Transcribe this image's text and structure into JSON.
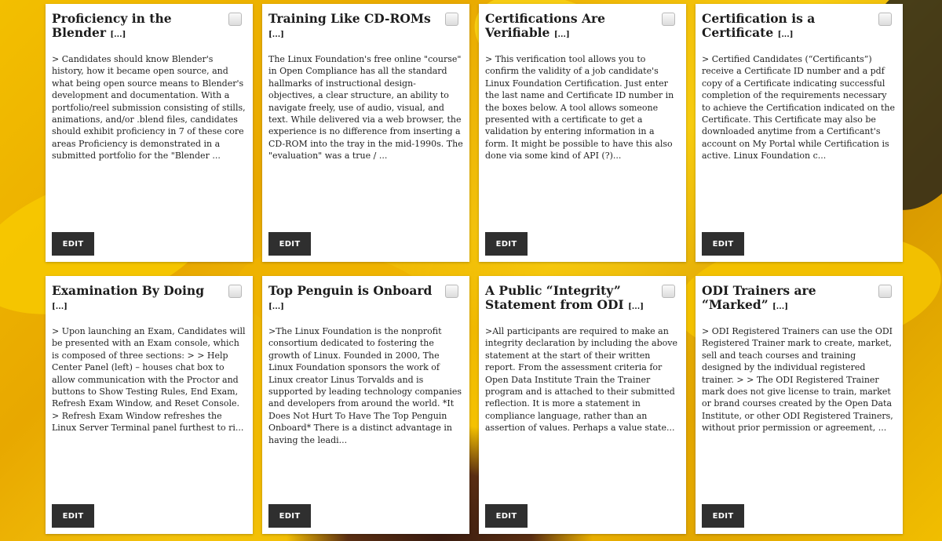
{
  "cards": [
    {
      "title": "Proficiency in the Blender",
      "more": "[...]",
      "body": "> Candidates should know Blender's history, how it became open source, and what being open source means to Blender's development and documentation. With a portfolio/reel submission consisting of stills, animations, and/or .blend files, candidates should exhibit proficiency in 7 of these core areas Proficiency is demonstrated in a submitted portfolio for the \"Blender ...",
      "edit": "EDIT"
    },
    {
      "title": "Training Like CD-ROMs",
      "more": "[...]",
      "body": "The Linux Foundation's free online \"course\" in Open Compliance has all the standard hallmarks of instructional design- objectives, a clear structure, an ability to navigate freely, use of audio, visual, and text. While delivered via a web browser, the experience is no difference from inserting a CD-ROM into the tray in the mid-1990s. The \"evaluation\" was a true / ...",
      "edit": "EDIT"
    },
    {
      "title": "Certifications Are Verifiable",
      "more": "[...]",
      "body": "> This verification tool allows you to confirm the validity of a job candidate's Linux Foundation Certification. Just enter the last name and Certificate ID number in the boxes below. A tool allows someone presented with a certificate to get a validation by entering information in a form. It might be possible to have this also done via some kind of API (?)...",
      "edit": "EDIT"
    },
    {
      "title": "Certification is a Certificate",
      "more": "[...]",
      "body": "> Certified Candidates (“Certificants”) receive a Certificate ID number and a pdf copy of a Certificate indicating successful completion of the requirements necessary to achieve the Certification indicated on the Certificate. This Certificate may also be downloaded anytime from a Certificant's account on My Portal while Certification is active. Linux Foundation c...",
      "edit": "EDIT"
    },
    {
      "title": "Examination By Doing",
      "more": "[...]",
      "body": "> Upon launching an Exam, Candidates will be presented with an Exam console, which is composed of three sections: > > Help Center Panel (left) – houses chat box to allow communication with the Proctor and buttons to Show Testing Rules, End Exam, Refresh Exam Window, and Reset Console. > Refresh Exam Window refreshes the Linux Server Terminal panel furthest to ri...",
      "edit": "EDIT"
    },
    {
      "title": "Top Penguin is Onboard",
      "more": "[...]",
      "body": ">The Linux Foundation is the nonprofit consortium dedicated to fostering the growth of Linux. Founded in 2000, The Linux Foundation sponsors the work of Linux creator Linus Torvalds and is supported by leading technology companies and developers from around the world. *It Does Not Hurt To Have The Top Penguin Onboard* There is a distinct advantage in having the leadi...",
      "edit": "EDIT"
    },
    {
      "title": "A Public “Integrity” Statement from ODI",
      "more": "[...]",
      "body": ">All participants are required to make an integrity declaration by including the above statement at the start of their written report. From the assessment criteria for Open Data Institute Train the Trainer program and is attached to their submitted reflection. It is more a statement in compliance language, rather than an assertion of values. Perhaps a value state...",
      "edit": "EDIT"
    },
    {
      "title": "ODI Trainers are “Marked”",
      "more": "[...]",
      "body": "> ODI Registered Trainers can use the ODI Registered Trainer mark to create, market, sell and teach courses and training designed by the individual registered trainer. > > The ODI Registered Trainer mark does not give license to train, market or brand courses created by the Open Data Institute, or other ODI Registered Trainers, without prior permission or agreement, ...",
      "edit": "EDIT"
    }
  ]
}
